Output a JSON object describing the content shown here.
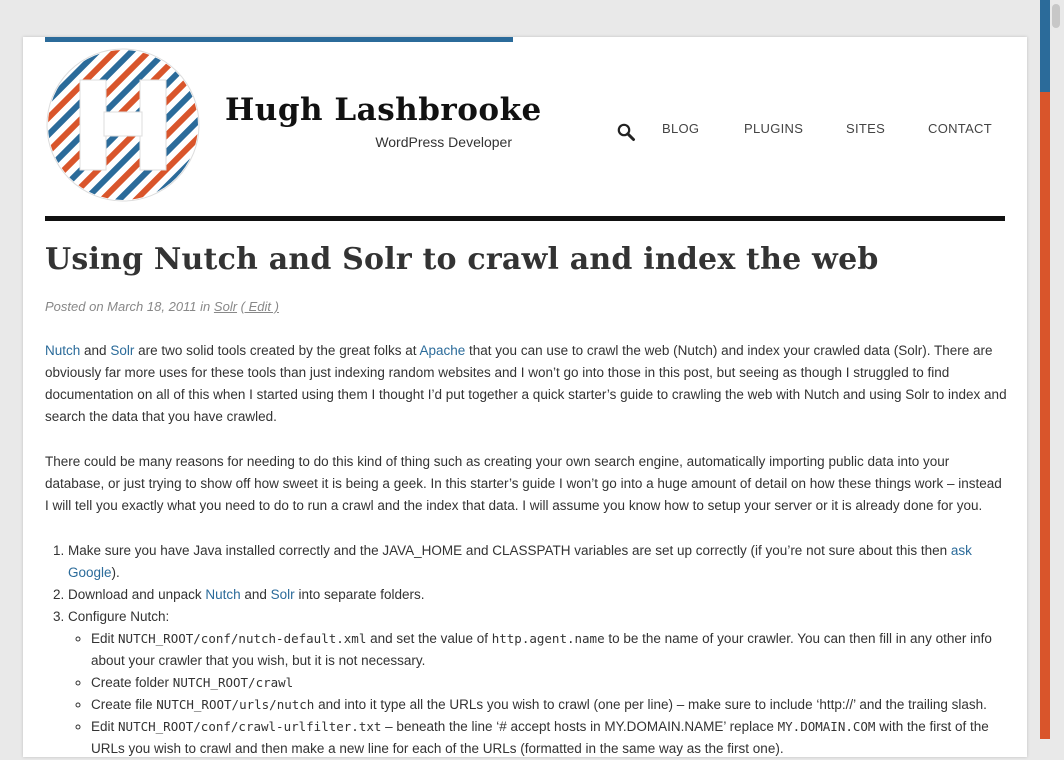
{
  "site": {
    "title": "Hugh Lashbrooke",
    "tagline": "WordPress Developer",
    "logo_letter": "H",
    "colors": {
      "blue": "#2b6b9a",
      "orange": "#d9552b",
      "dark": "#111111"
    }
  },
  "nav": {
    "search_icon": "search-icon",
    "items": [
      "BLOG",
      "PLUGINS",
      "SITES",
      "CONTACT"
    ]
  },
  "post": {
    "title": "Using Nutch and Solr to crawl and index the web",
    "meta": {
      "posted_on": "Posted on",
      "date": "March 18, 2011",
      "in": "in",
      "category": "Solr",
      "edit": "( Edit )"
    },
    "p1": {
      "link_nutch": "Nutch",
      "and": " and ",
      "link_solr": "Solr",
      "text_a": " are two solid tools created by the great folks at ",
      "link_apache": "Apache",
      "text_b": " that you can use to crawl the web (Nutch) and index your crawled data (Solr). There are obviously far more uses for these tools than just indexing random websites and I won’t go into those in this post, but seeing as though I struggled to find documentation on all of this when I started using them I thought I’d put together a quick starter’s guide to crawling the web with Nutch and using Solr to index and search the data that you have crawled."
    },
    "p2": "There could be many reasons for needing to do this kind of thing such as creating your own search engine, automatically importing public data into your database, or just trying to show off how sweet it is being a geek. In this starter’s guide I won’t go into a huge amount of detail on how these things work – instead I will tell you exactly what you need to do to run a crawl and the index that data. I will assume you know how to setup your server or it is already done for you.",
    "steps": {
      "s1_text": "Make sure you have Java installed correctly and the JAVA_HOME and CLASSPATH variables are set up correctly (if you’re not sure about this then ",
      "s1_link": "ask Google",
      "s1_end": ").",
      "s2_a": "Download and unpack ",
      "s2_link_nutch": "Nutch",
      "s2_and": " and ",
      "s2_link_solr": "Solr",
      "s2_b": " into separate folders.",
      "s3": "Configure Nutch:",
      "sub1_a": "Edit ",
      "sub1_code1": "NUTCH_ROOT/conf/nutch-default.xml",
      "sub1_b": " and set the value of ",
      "sub1_code2": "http.agent.name",
      "sub1_c": " to be the name of your crawler. You can then fill in any other info about your crawler that you wish, but it is not necessary.",
      "sub2_a": "Create folder ",
      "sub2_code": "NUTCH_ROOT/crawl",
      "sub3_a": "Create file ",
      "sub3_code": "NUTCH_ROOT/urls/nutch",
      "sub3_b": " and into it type all the URLs you wish to crawl (one per line)  – make sure to include ‘http://’ and the trailing slash.",
      "sub4_a": "Edit ",
      "sub4_code1": "NUTCH_ROOT/conf/crawl-urlfilter.txt",
      "sub4_b": " – beneath the line ‘# accept hosts in MY.DOMAIN.NAME’ replace ",
      "sub4_code2": "MY.DOMAIN.COM",
      "sub4_c": " with the first of the URLs you wish to crawl and then make a new line for each of the URLs (formatted in the same way as the first one)."
    }
  }
}
